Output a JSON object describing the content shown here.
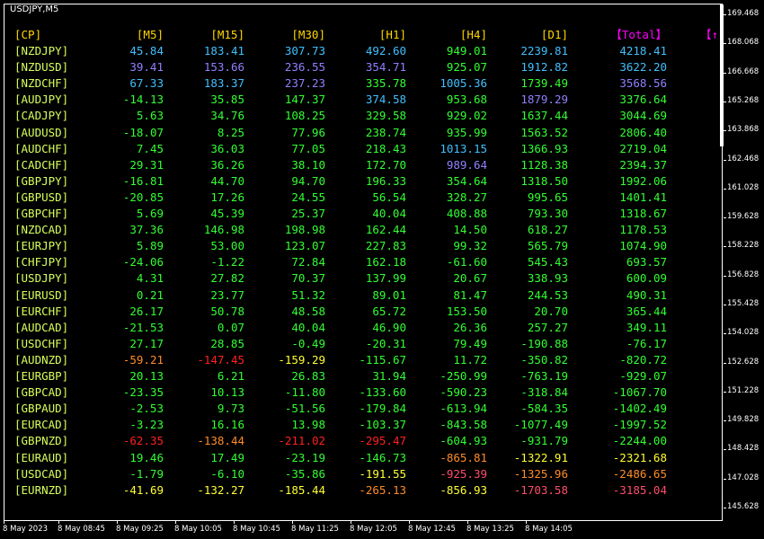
{
  "window": {
    "symbol": "USDJPY,M5"
  },
  "colors": {
    "cyan": "#40c0ff",
    "violet": "#9080ff",
    "lime": "#32ff32",
    "olive": "#d7ff5a",
    "yellow": "#ffff32",
    "orange": "#ff8c28",
    "red": "#ff2020",
    "pink": "#ff4d6a",
    "gold": "#ffd700",
    "magenta": "#ff00ff",
    "white": "#ffffff"
  },
  "table": {
    "headers": [
      {
        "text": "[CP]",
        "color": "#ffd700"
      },
      {
        "text": "[M5]",
        "color": "#ffd700"
      },
      {
        "text": "[M15]",
        "color": "#ffd700"
      },
      {
        "text": "[M30]",
        "color": "#ffd700"
      },
      {
        "text": "[H1]",
        "color": "#ffd700"
      },
      {
        "text": "[H4]",
        "color": "#ffd700"
      },
      {
        "text": "[D1]",
        "color": "#ffd700"
      },
      {
        "text": "【Total】",
        "color": "#ff00ff"
      },
      {
        "text": "【↑",
        "color": "#ff00ff"
      }
    ],
    "rows": [
      {
        "pair": "[NZDJPY]",
        "v": [
          [
            "45.84",
            "cyan"
          ],
          [
            "183.41",
            "cyan"
          ],
          [
            "307.73",
            "cyan"
          ],
          [
            "492.60",
            "cyan"
          ],
          [
            "949.01",
            "lime"
          ],
          [
            "2239.81",
            "cyan"
          ],
          [
            "4218.41",
            "cyan"
          ]
        ]
      },
      {
        "pair": "[NZDUSD]",
        "v": [
          [
            "39.41",
            "violet"
          ],
          [
            "153.66",
            "violet"
          ],
          [
            "236.55",
            "violet"
          ],
          [
            "354.71",
            "violet"
          ],
          [
            "925.07",
            "lime"
          ],
          [
            "1912.82",
            "cyan"
          ],
          [
            "3622.20",
            "cyan"
          ]
        ]
      },
      {
        "pair": "[NZDCHF]",
        "v": [
          [
            "67.33",
            "cyan"
          ],
          [
            "183.37",
            "cyan"
          ],
          [
            "237.23",
            "violet"
          ],
          [
            "335.78",
            "lime"
          ],
          [
            "1005.36",
            "cyan"
          ],
          [
            "1739.49",
            "lime"
          ],
          [
            "3568.56",
            "violet"
          ]
        ]
      },
      {
        "pair": "[AUDJPY]",
        "v": [
          [
            "-14.13",
            "lime"
          ],
          [
            "35.85",
            "lime"
          ],
          [
            "147.37",
            "lime"
          ],
          [
            "374.58",
            "cyan"
          ],
          [
            "953.68",
            "lime"
          ],
          [
            "1879.29",
            "violet"
          ],
          [
            "3376.64",
            "lime"
          ]
        ]
      },
      {
        "pair": "[CADJPY]",
        "v": [
          [
            "5.63",
            "lime"
          ],
          [
            "34.76",
            "lime"
          ],
          [
            "108.25",
            "lime"
          ],
          [
            "329.58",
            "lime"
          ],
          [
            "929.02",
            "lime"
          ],
          [
            "1637.44",
            "lime"
          ],
          [
            "3044.69",
            "lime"
          ]
        ]
      },
      {
        "pair": "[AUDUSD]",
        "v": [
          [
            "-18.07",
            "lime"
          ],
          [
            "8.25",
            "lime"
          ],
          [
            "77.96",
            "lime"
          ],
          [
            "238.74",
            "lime"
          ],
          [
            "935.99",
            "lime"
          ],
          [
            "1563.52",
            "lime"
          ],
          [
            "2806.40",
            "lime"
          ]
        ]
      },
      {
        "pair": "[AUDCHF]",
        "v": [
          [
            "7.45",
            "lime"
          ],
          [
            "36.03",
            "lime"
          ],
          [
            "77.05",
            "lime"
          ],
          [
            "218.43",
            "lime"
          ],
          [
            "1013.15",
            "cyan"
          ],
          [
            "1366.93",
            "lime"
          ],
          [
            "2719.04",
            "lime"
          ]
        ]
      },
      {
        "pair": "[CADCHF]",
        "v": [
          [
            "29.31",
            "lime"
          ],
          [
            "36.26",
            "lime"
          ],
          [
            "38.10",
            "lime"
          ],
          [
            "172.70",
            "lime"
          ],
          [
            "989.64",
            "violet"
          ],
          [
            "1128.38",
            "lime"
          ],
          [
            "2394.37",
            "lime"
          ]
        ]
      },
      {
        "pair": "[GBPJPY]",
        "v": [
          [
            "-16.81",
            "lime"
          ],
          [
            "44.70",
            "lime"
          ],
          [
            "94.70",
            "lime"
          ],
          [
            "196.33",
            "lime"
          ],
          [
            "354.64",
            "lime"
          ],
          [
            "1318.50",
            "lime"
          ],
          [
            "1992.06",
            "lime"
          ]
        ]
      },
      {
        "pair": "[GBPUSD]",
        "v": [
          [
            "-20.85",
            "lime"
          ],
          [
            "17.26",
            "lime"
          ],
          [
            "24.55",
            "lime"
          ],
          [
            "56.54",
            "lime"
          ],
          [
            "328.27",
            "lime"
          ],
          [
            "995.65",
            "lime"
          ],
          [
            "1401.41",
            "lime"
          ]
        ]
      },
      {
        "pair": "[GBPCHF]",
        "v": [
          [
            "5.69",
            "lime"
          ],
          [
            "45.39",
            "lime"
          ],
          [
            "25.37",
            "lime"
          ],
          [
            "40.04",
            "lime"
          ],
          [
            "408.88",
            "lime"
          ],
          [
            "793.30",
            "lime"
          ],
          [
            "1318.67",
            "lime"
          ]
        ]
      },
      {
        "pair": "[NZDCAD]",
        "v": [
          [
            "37.36",
            "lime"
          ],
          [
            "146.98",
            "lime"
          ],
          [
            "198.98",
            "lime"
          ],
          [
            "162.44",
            "lime"
          ],
          [
            "14.50",
            "lime"
          ],
          [
            "618.27",
            "lime"
          ],
          [
            "1178.53",
            "lime"
          ]
        ]
      },
      {
        "pair": "[EURJPY]",
        "v": [
          [
            "5.89",
            "lime"
          ],
          [
            "53.00",
            "lime"
          ],
          [
            "123.07",
            "lime"
          ],
          [
            "227.83",
            "lime"
          ],
          [
            "99.32",
            "lime"
          ],
          [
            "565.79",
            "lime"
          ],
          [
            "1074.90",
            "lime"
          ]
        ]
      },
      {
        "pair": "[CHFJPY]",
        "v": [
          [
            "-24.06",
            "lime"
          ],
          [
            "-1.22",
            "lime"
          ],
          [
            "72.84",
            "lime"
          ],
          [
            "162.18",
            "lime"
          ],
          [
            "-61.60",
            "lime"
          ],
          [
            "545.43",
            "lime"
          ],
          [
            "693.57",
            "lime"
          ]
        ]
      },
      {
        "pair": "[USDJPY]",
        "v": [
          [
            "4.31",
            "lime"
          ],
          [
            "27.82",
            "lime"
          ],
          [
            "70.37",
            "lime"
          ],
          [
            "137.99",
            "lime"
          ],
          [
            "20.67",
            "lime"
          ],
          [
            "338.93",
            "lime"
          ],
          [
            "600.09",
            "lime"
          ]
        ]
      },
      {
        "pair": "[EURUSD]",
        "v": [
          [
            "0.21",
            "lime"
          ],
          [
            "23.77",
            "lime"
          ],
          [
            "51.32",
            "lime"
          ],
          [
            "89.01",
            "lime"
          ],
          [
            "81.47",
            "lime"
          ],
          [
            "244.53",
            "lime"
          ],
          [
            "490.31",
            "lime"
          ]
        ]
      },
      {
        "pair": "[EURCHF]",
        "v": [
          [
            "26.17",
            "lime"
          ],
          [
            "50.78",
            "lime"
          ],
          [
            "48.58",
            "lime"
          ],
          [
            "65.72",
            "lime"
          ],
          [
            "153.50",
            "lime"
          ],
          [
            "20.70",
            "lime"
          ],
          [
            "365.44",
            "lime"
          ]
        ]
      },
      {
        "pair": "[AUDCAD]",
        "v": [
          [
            "-21.53",
            "lime"
          ],
          [
            "0.07",
            "lime"
          ],
          [
            "40.04",
            "lime"
          ],
          [
            "46.90",
            "lime"
          ],
          [
            "26.36",
            "lime"
          ],
          [
            "257.27",
            "lime"
          ],
          [
            "349.11",
            "lime"
          ]
        ]
      },
      {
        "pair": "[USDCHF]",
        "v": [
          [
            "27.17",
            "lime"
          ],
          [
            "28.85",
            "lime"
          ],
          [
            "-0.49",
            "lime"
          ],
          [
            "-20.31",
            "lime"
          ],
          [
            "79.49",
            "lime"
          ],
          [
            "-190.88",
            "lime"
          ],
          [
            "-76.17",
            "lime"
          ]
        ]
      },
      {
        "pair": "[AUDNZD]",
        "v": [
          [
            "-59.21",
            "orange"
          ],
          [
            "-147.45",
            "red"
          ],
          [
            "-159.29",
            "yellow"
          ],
          [
            "-115.67",
            "lime"
          ],
          [
            "11.72",
            "lime"
          ],
          [
            "-350.82",
            "lime"
          ],
          [
            "-820.72",
            "lime"
          ]
        ]
      },
      {
        "pair": "[EURGBP]",
        "v": [
          [
            "20.13",
            "lime"
          ],
          [
            "6.21",
            "lime"
          ],
          [
            "26.83",
            "lime"
          ],
          [
            "31.94",
            "lime"
          ],
          [
            "-250.99",
            "lime"
          ],
          [
            "-763.19",
            "lime"
          ],
          [
            "-929.07",
            "lime"
          ]
        ]
      },
      {
        "pair": "[GBPCAD]",
        "v": [
          [
            "-23.35",
            "lime"
          ],
          [
            "10.13",
            "lime"
          ],
          [
            "-11.80",
            "lime"
          ],
          [
            "-133.60",
            "lime"
          ],
          [
            "-590.23",
            "lime"
          ],
          [
            "-318.84",
            "lime"
          ],
          [
            "-1067.70",
            "lime"
          ]
        ]
      },
      {
        "pair": "[GBPAUD]",
        "v": [
          [
            "-2.53",
            "lime"
          ],
          [
            "9.73",
            "lime"
          ],
          [
            "-51.56",
            "lime"
          ],
          [
            "-179.84",
            "lime"
          ],
          [
            "-613.94",
            "lime"
          ],
          [
            "-584.35",
            "lime"
          ],
          [
            "-1402.49",
            "lime"
          ]
        ]
      },
      {
        "pair": "[EURCAD]",
        "v": [
          [
            "-3.23",
            "lime"
          ],
          [
            "16.16",
            "lime"
          ],
          [
            "13.98",
            "lime"
          ],
          [
            "-103.37",
            "lime"
          ],
          [
            "-843.58",
            "lime"
          ],
          [
            "-1077.49",
            "lime"
          ],
          [
            "-1997.52",
            "lime"
          ]
        ]
      },
      {
        "pair": "[GBPNZD]",
        "v": [
          [
            "-62.35",
            "red"
          ],
          [
            "-138.44",
            "orange"
          ],
          [
            "-211.02",
            "red"
          ],
          [
            "-295.47",
            "red"
          ],
          [
            "-604.93",
            "lime"
          ],
          [
            "-931.79",
            "lime"
          ],
          [
            "-2244.00",
            "lime"
          ]
        ]
      },
      {
        "pair": "[EURAUD]",
        "v": [
          [
            "19.46",
            "lime"
          ],
          [
            "17.49",
            "lime"
          ],
          [
            "-23.19",
            "lime"
          ],
          [
            "-146.73",
            "lime"
          ],
          [
            "-865.81",
            "orange"
          ],
          [
            "-1322.91",
            "yellow"
          ],
          [
            "-2321.68",
            "yellow"
          ]
        ]
      },
      {
        "pair": "[USDCAD]",
        "v": [
          [
            "-1.79",
            "lime"
          ],
          [
            "-6.10",
            "lime"
          ],
          [
            "-35.86",
            "lime"
          ],
          [
            "-191.55",
            "yellow"
          ],
          [
            "-925.39",
            "pink"
          ],
          [
            "-1325.96",
            "orange"
          ],
          [
            "-2486.65",
            "orange"
          ]
        ]
      },
      {
        "pair": "[EURNZD]",
        "v": [
          [
            "-41.69",
            "yellow"
          ],
          [
            "-132.27",
            "yellow"
          ],
          [
            "-185.44",
            "yellow"
          ],
          [
            "-265.13",
            "orange"
          ],
          [
            "-856.93",
            "yellow"
          ],
          [
            "-1703.58",
            "pink"
          ],
          [
            "-3185.04",
            "pink"
          ]
        ]
      }
    ]
  },
  "price_axis": [
    "169.468",
    "168.068",
    "166.668",
    "165.268",
    "163.868",
    "162.468",
    "161.028",
    "159.628",
    "158.228",
    "156.828",
    "155.428",
    "154.028",
    "152.628",
    "151.228",
    "149.828",
    "148.428",
    "147.028",
    "145.628"
  ],
  "time_axis": [
    "8 May 2023",
    "8 May 08:45",
    "8 May 09:25",
    "8 May 10:05",
    "8 May 10:45",
    "8 May 11:25",
    "8 May 12:05",
    "8 May 12:45",
    "8 May 13:25",
    "8 May 14:05"
  ]
}
